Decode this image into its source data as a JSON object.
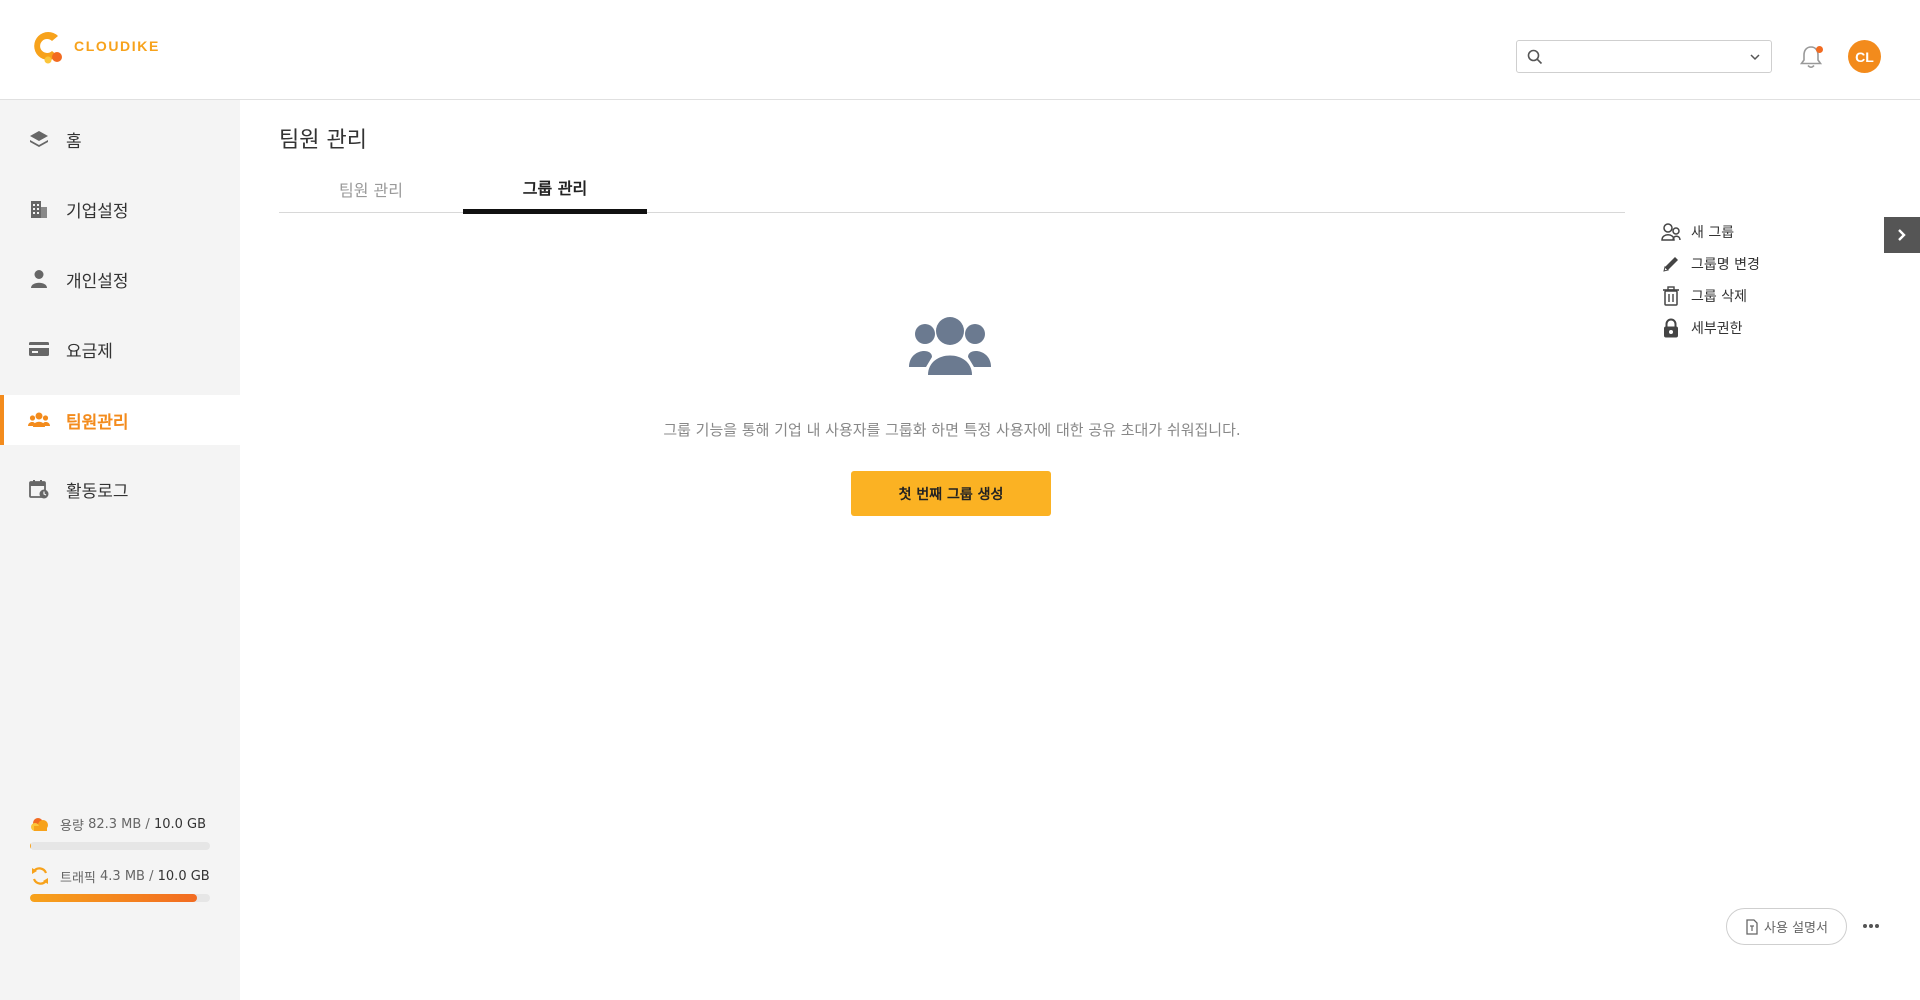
{
  "brand": {
    "name": "CLOUDIKE",
    "accent": "#f38b1c",
    "button": "#fbb223"
  },
  "header": {
    "search": {
      "placeholder": "",
      "value": ""
    },
    "notifications": {
      "has_unread": true
    },
    "avatar_initials": "CL"
  },
  "sidebar": {
    "items": [
      {
        "label": "홈",
        "icon": "layers-icon",
        "active": false
      },
      {
        "label": "기업설정",
        "icon": "building-icon",
        "active": false
      },
      {
        "label": "개인설정",
        "icon": "user-icon",
        "active": false
      },
      {
        "label": "요금제",
        "icon": "credit-card-icon",
        "active": false
      },
      {
        "label": "팀원관리",
        "icon": "users-icon",
        "active": true
      },
      {
        "label": "활동로그",
        "icon": "calendar-clock-icon",
        "active": false
      }
    ],
    "storage": {
      "prefix": "용량",
      "used": "82.3 MB",
      "separator": " / ",
      "total": "10.0 GB",
      "fraction": 0.008
    },
    "traffic": {
      "prefix": "트래픽",
      "used": "4.3 MB",
      "separator": " / ",
      "total": "10.0 GB",
      "fraction": 0.93
    }
  },
  "main": {
    "title": "팀원 관리",
    "tabs": [
      {
        "label": "팀원 관리",
        "active": false
      },
      {
        "label": "그룹 관리",
        "active": true
      }
    ],
    "empty_state": {
      "message": "그룹 기능을 통해 기업 내 사용자를 그룹화 하면 특정 사용자에 대한 공유 초대가 쉬워집니다.",
      "button_label": "첫 번째 그룹 생성"
    }
  },
  "actions": [
    {
      "label": "새 그룹",
      "icon": "user-plus-icon"
    },
    {
      "label": "그룹명 변경",
      "icon": "pencil-icon"
    },
    {
      "label": "그룹 삭제",
      "icon": "trash-icon"
    },
    {
      "label": "세부권한",
      "icon": "lock-icon"
    }
  ],
  "footer": {
    "manual_label": "사용 설명서",
    "more_icon": "more-icon"
  }
}
